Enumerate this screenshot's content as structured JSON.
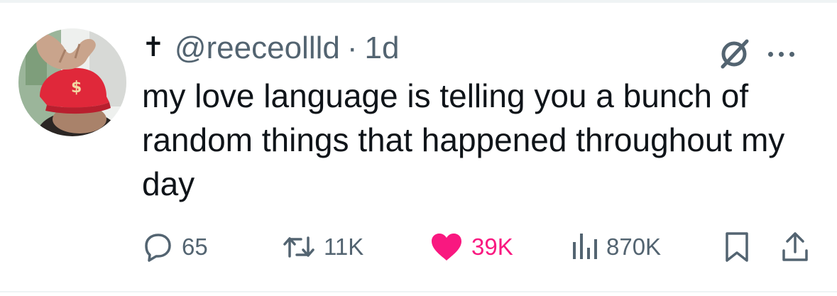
{
  "tweet": {
    "author_badge": "✝",
    "handle": "@reeceollld",
    "separator": "·",
    "time": "1d",
    "text": "my love language is telling you a bunch of random things that happened throughout my day"
  },
  "icons": {
    "top_right": [
      "grok-icon",
      "more-icon"
    ],
    "actions": [
      "reply-icon",
      "retweet-icon",
      "heart-icon",
      "views-icon",
      "bookmark-icon",
      "share-icon"
    ]
  },
  "actions": {
    "replies": "65",
    "retweets": "11K",
    "likes": "39K",
    "views": "870K"
  },
  "colors": {
    "text": "#0f1419",
    "secondary": "#536471",
    "like": "#f91880",
    "border": "#eff3f4"
  }
}
